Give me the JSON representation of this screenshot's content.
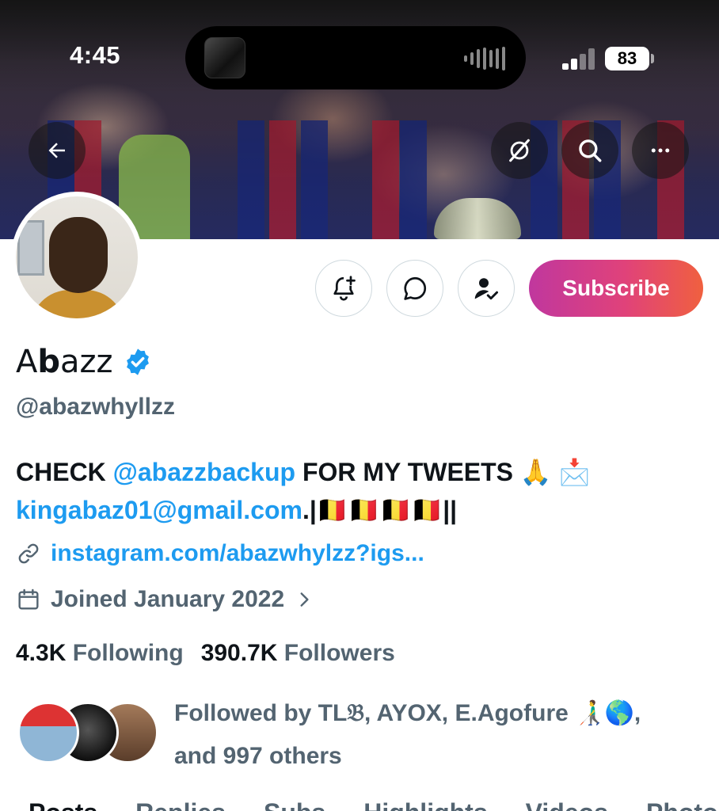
{
  "status_bar": {
    "time": "4:45",
    "battery": "83"
  },
  "banner": {
    "back_icon": "back-arrow-icon",
    "grok_icon": "grok-icon",
    "search_icon": "search-icon",
    "more_icon": "more-icon"
  },
  "actions": {
    "subscribe_label": "Subscribe",
    "icons": [
      "bell-plus-icon",
      "message-icon",
      "follow-status-icon"
    ],
    "subscribe_gradient": [
      "#c0379e",
      "#e0427a",
      "#f0603f"
    ]
  },
  "profile": {
    "display_name_bold": "b",
    "display_name_prefix": "A",
    "display_name_suffix": "azz",
    "handle": "@abazwhyllzz",
    "verified_color": "#1d9bf0",
    "bio": {
      "part1": "CHECK ",
      "mention": "@abazzbackup",
      "part2": " FOR MY TWEETS 🙏 📩",
      "email": "kingabaz01@gmail.com",
      "part3": ".|🇧🇪🇧🇪🇧🇪🇧🇪||"
    },
    "website": "instagram.com/abazwhylzz?igs...",
    "joined": "Joined January 2022",
    "following_count": "4.3K",
    "following_label": "Following",
    "followers_count": "390.7K",
    "followers_label": "Followers",
    "followed_by_text": "Followed by TL𝔅, AYOX, E.Agofure 👨‍🦯🌎,",
    "followed_by_more": "and 997 others"
  },
  "tabs": [
    "Posts",
    "Replies",
    "Subs",
    "Highlights",
    "Videos",
    "Photos"
  ],
  "colors": {
    "link": "#1d9bf0",
    "secondary_text": "#536471",
    "primary_text": "#0f1419"
  }
}
